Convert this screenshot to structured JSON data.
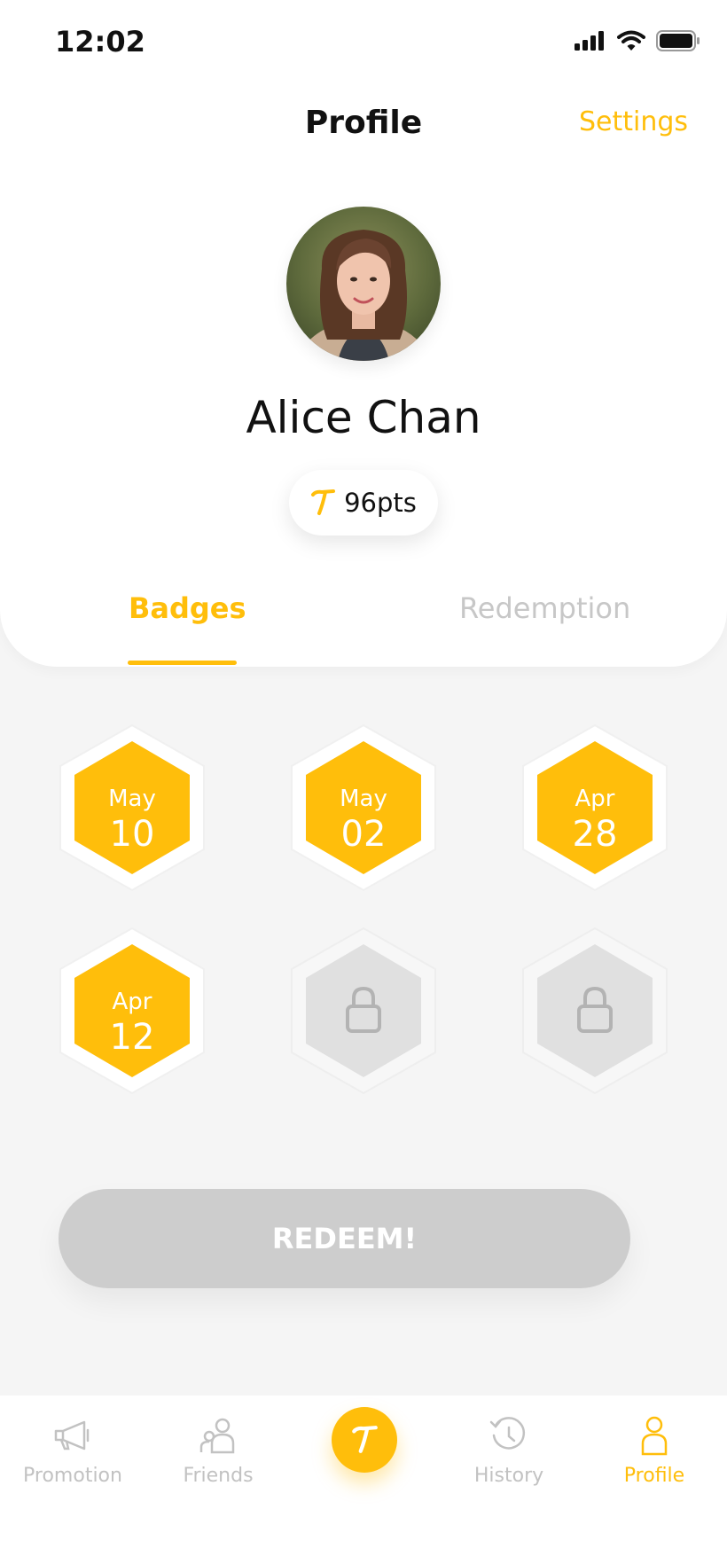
{
  "status_bar": {
    "time": "12:02"
  },
  "header": {
    "title": "Profile",
    "settings_label": "Settings"
  },
  "profile": {
    "name": "Alice Chan",
    "points": "96pts"
  },
  "tabs": [
    {
      "label": "Badges",
      "active": true
    },
    {
      "label": "Redemption",
      "active": false
    }
  ],
  "badges": [
    {
      "month": "May",
      "day": "10",
      "unlocked": true
    },
    {
      "month": "May",
      "day": "02",
      "unlocked": true
    },
    {
      "month": "Apr",
      "day": "28",
      "unlocked": true
    },
    {
      "month": "Apr",
      "day": "12",
      "unlocked": true
    },
    {
      "month": "",
      "day": "",
      "unlocked": false
    },
    {
      "month": "",
      "day": "",
      "unlocked": false
    }
  ],
  "redeem_button": {
    "label": "REDEEM!"
  },
  "bottom_nav": [
    {
      "label": "Promotion",
      "icon": "megaphone-icon",
      "active": false
    },
    {
      "label": "Friends",
      "icon": "friends-icon",
      "active": false
    },
    {
      "label": "History",
      "icon": "history-icon",
      "active": false
    },
    {
      "label": "Profile",
      "icon": "person-icon",
      "active": true
    }
  ],
  "colors": {
    "accent": "#ffbe0b",
    "inactive": "#c2c2c2",
    "button_disabled": "#cdcdcd",
    "background": "#f5f5f5"
  }
}
